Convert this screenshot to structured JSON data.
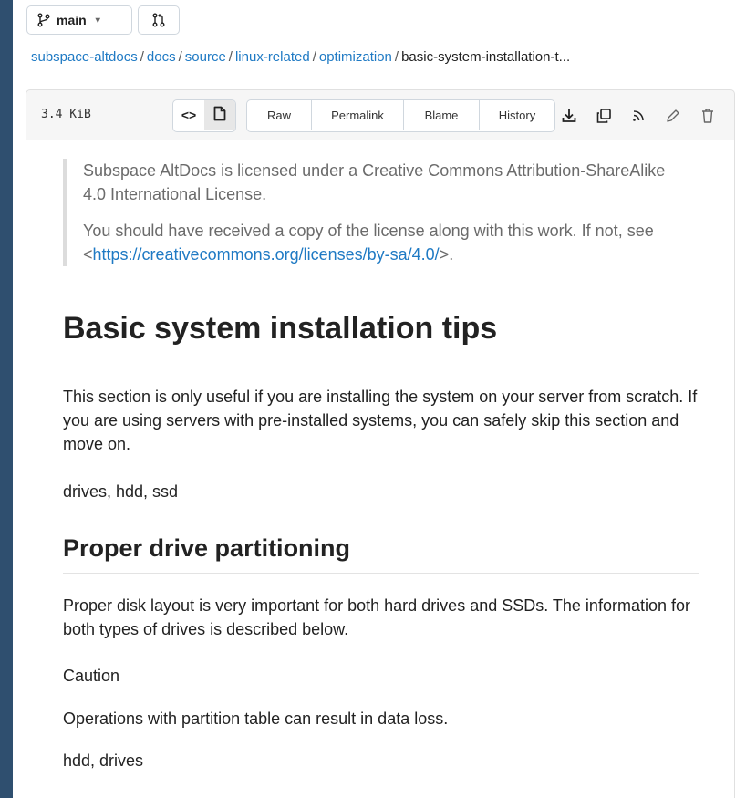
{
  "branch": {
    "name": "main"
  },
  "breadcrumb": {
    "links": [
      "subspace-altdocs",
      "docs",
      "source",
      "linux-related",
      "optimization"
    ],
    "separator": "/",
    "current": "basic-system-installation-t..."
  },
  "filebar": {
    "size": "3.4 KiB",
    "buttons": [
      "Raw",
      "Permalink",
      "Blame",
      "History"
    ],
    "icons": [
      "download-icon",
      "copy-icon",
      "rss-icon",
      "edit-icon",
      "delete-icon"
    ]
  },
  "content": {
    "license": {
      "line1": "Subspace AltDocs is licensed under a Creative Commons Attribution-ShareAlike 4.0 International License.",
      "line2_prefix": "You should have received a copy of the license along with this work. If not, see <",
      "line2_link": "https://creativecommons.org/licenses/by-sa/4.0/",
      "line2_suffix": ">."
    },
    "title": "Basic system installation tips",
    "intro": "This section is only useful if you are installing the system on your server from scratch. If you are using servers with pre-installed systems, you can safely skip this section and move on.",
    "tags1": "drives, hdd, ssd",
    "section_title": "Proper drive partitioning",
    "section_text": "Proper disk layout is very important for both hard drives and SSDs. The information for both types of drives is described below.",
    "caution_label": "Caution",
    "caution_text": "Operations with partition table can result in data loss.",
    "tags2": "hdd, drives"
  }
}
